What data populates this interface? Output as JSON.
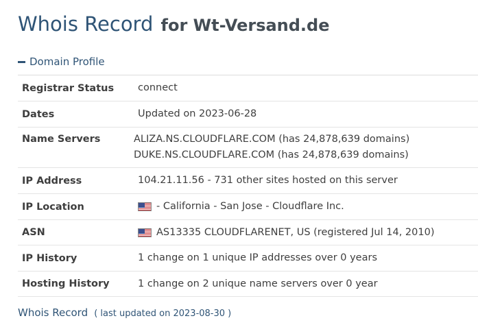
{
  "header": {
    "title_main": "Whois Record",
    "title_sub": "for Wt-Versand.de"
  },
  "section": {
    "label": "Domain Profile",
    "icon": "minus-icon"
  },
  "profile": {
    "registrar_status": {
      "label": "Registrar Status",
      "value": "connect"
    },
    "dates": {
      "label": "Dates",
      "value": "Updated on 2023-06-28"
    },
    "name_servers": {
      "label": "Name Servers",
      "values": [
        "ALIZA.NS.CLOUDFLARE.COM (has 24,878,639 domains)",
        "DUKE.NS.CLOUDFLARE.COM (has 24,878,639 domains)"
      ]
    },
    "ip_address": {
      "label": "IP Address",
      "value": "104.21.11.56 - 731 other sites hosted on this server"
    },
    "ip_location": {
      "label": "IP Location",
      "value": "- California - San Jose - Cloudflare Inc.",
      "icon": "us-flag-icon"
    },
    "asn": {
      "label": "ASN",
      "value": "AS13335 CLOUDFLARENET, US (registered Jul 14, 2010)",
      "icon": "us-flag-icon"
    },
    "ip_history": {
      "label": "IP History",
      "value": "1 change on 1 unique IP addresses over 0 years"
    },
    "hosting_history": {
      "label": "Hosting History",
      "value": "1 change on 2 unique name servers over 0 year"
    }
  },
  "footer": {
    "link_label": "Whois Record",
    "note": "( last updated on 2023-08-30 )"
  },
  "colors": {
    "heading": "#2f5476",
    "text": "#3e3e3e",
    "divider": "#e4e4e4"
  }
}
